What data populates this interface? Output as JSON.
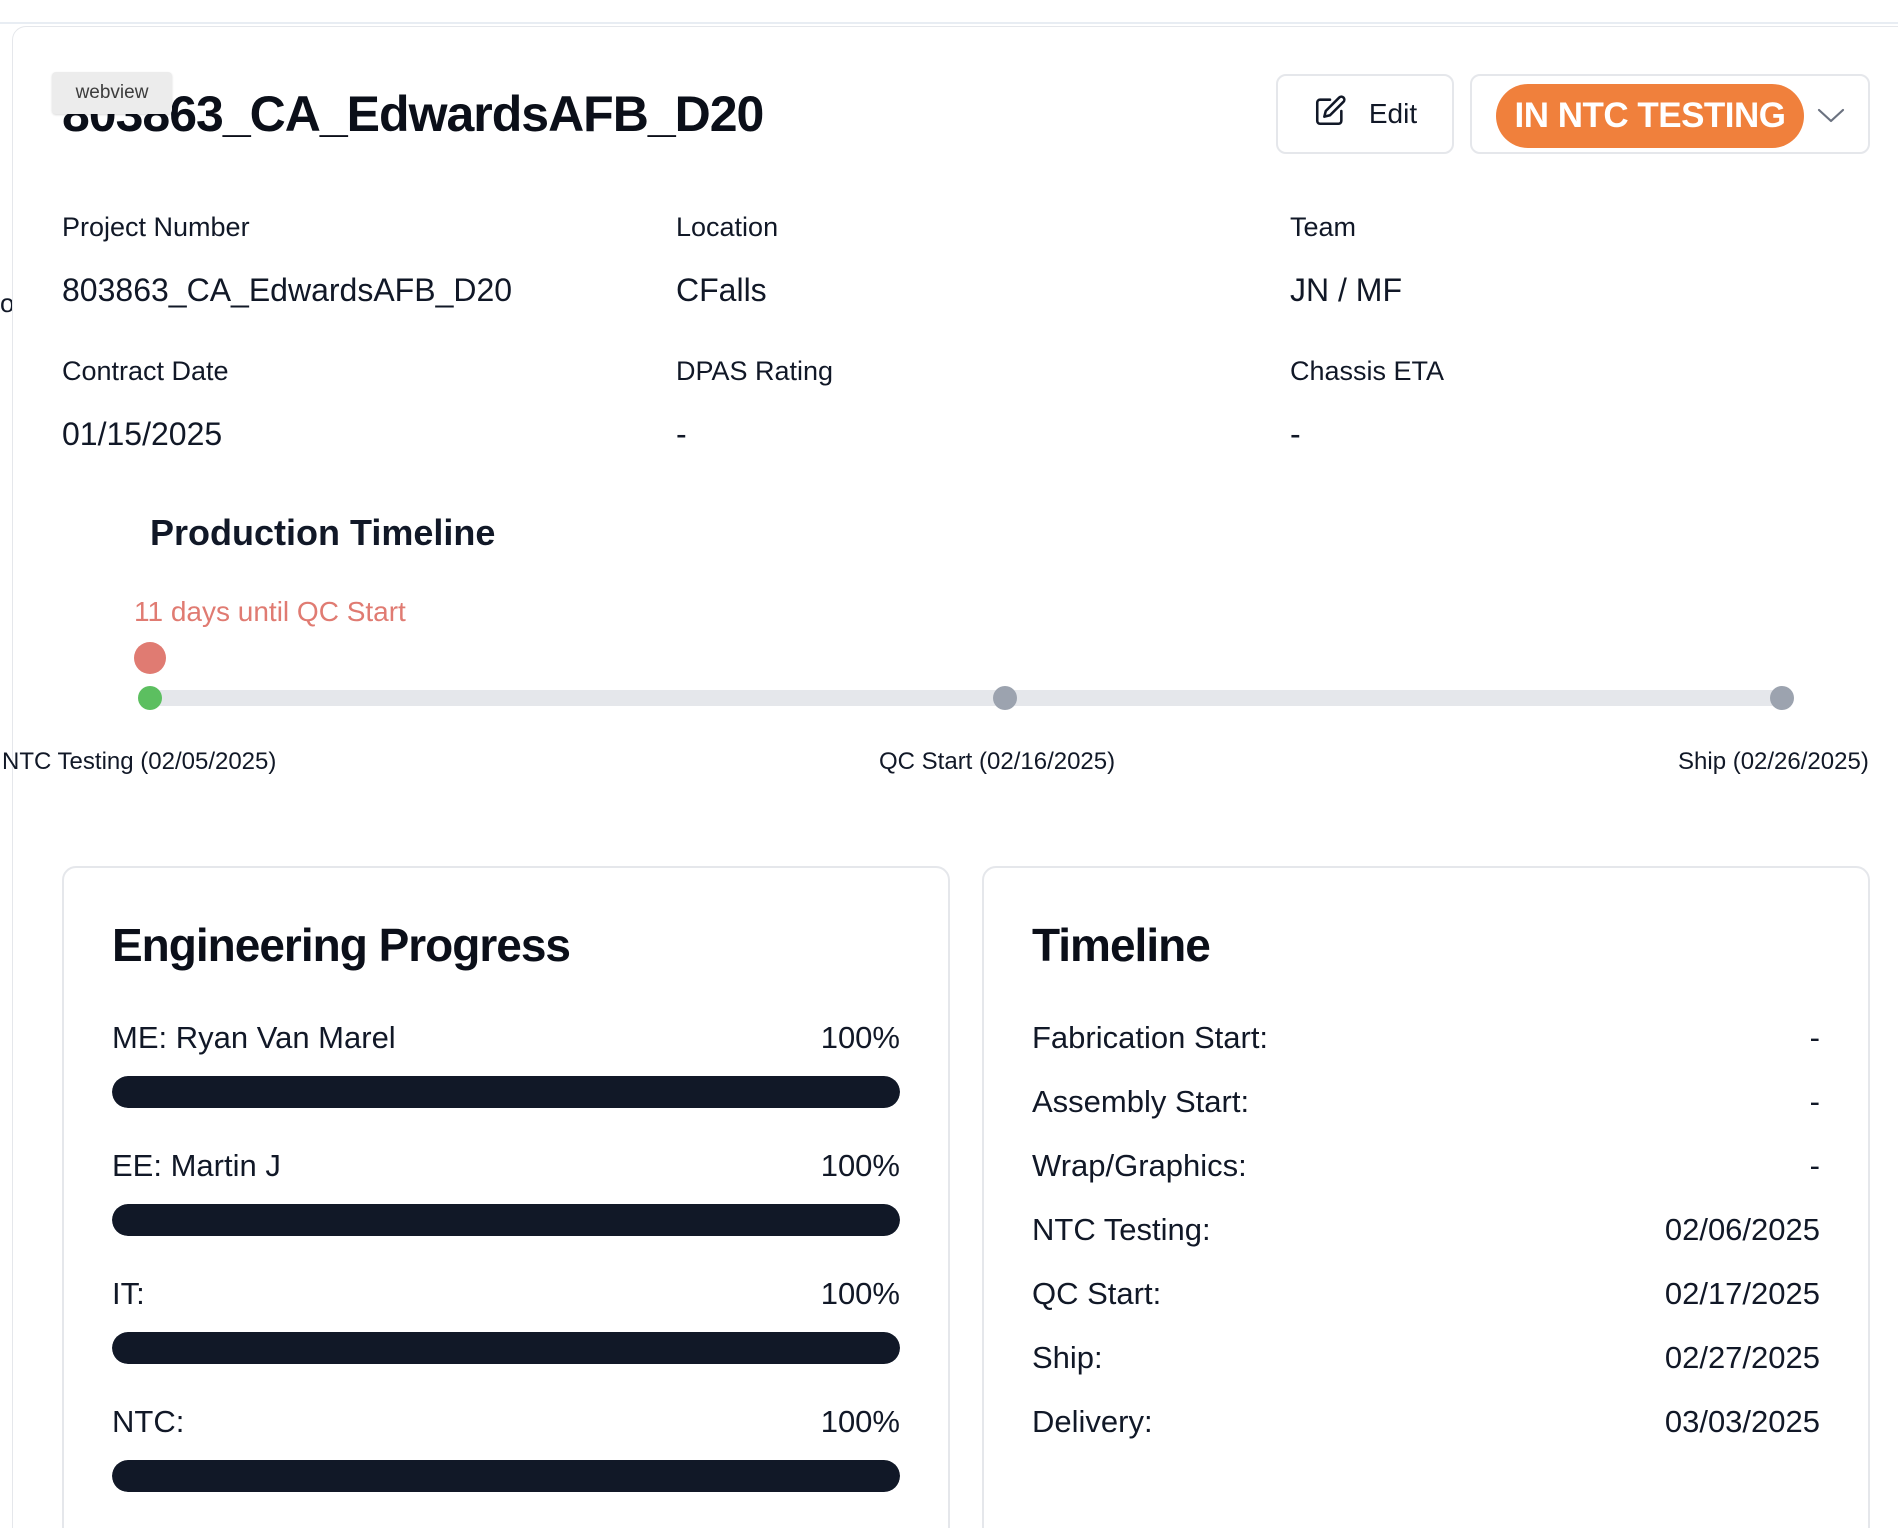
{
  "backdrop": {
    "fragment": "o."
  },
  "webview_tag": "webview",
  "project": {
    "title": "803863_CA_EdwardsAFB_D20",
    "edit_label": "Edit",
    "status_label": "IN NTC TESTING",
    "status_color": "#f0803c"
  },
  "info": [
    {
      "label": "Project Number",
      "value": "803863_CA_EdwardsAFB_D20"
    },
    {
      "label": "Location",
      "value": "CFalls"
    },
    {
      "label": "Team",
      "value": "JN / MF"
    },
    {
      "label": "Contract Date",
      "value": "01/15/2025"
    },
    {
      "label": "DPAS Rating",
      "value": "-"
    },
    {
      "label": "Chassis ETA",
      "value": "-"
    }
  ],
  "production_timeline": {
    "heading": "Production Timeline",
    "countdown": "11 days until QC Start",
    "countdown_color": "#e07b72",
    "milestones": [
      {
        "label": "NTC Testing (02/05/2025)",
        "state": "complete",
        "color": "#5cbf60"
      },
      {
        "label": "QC Start (02/16/2025)",
        "state": "upcoming",
        "color": "#9ca3af"
      },
      {
        "label": "Ship (02/26/2025)",
        "state": "upcoming",
        "color": "#9ca3af"
      }
    ]
  },
  "engineering": {
    "title": "Engineering Progress",
    "items": [
      {
        "name": "ME: Ryan Van Marel",
        "percent_label": "100%",
        "fraction": 1.0
      },
      {
        "name": "EE: Martin J",
        "percent_label": "100%",
        "fraction": 1.0
      },
      {
        "name": "IT:",
        "percent_label": "100%",
        "fraction": 1.0
      },
      {
        "name": "NTC:",
        "percent_label": "100%",
        "fraction": 1.0
      }
    ]
  },
  "timeline": {
    "title": "Timeline",
    "rows": [
      {
        "label": "Fabrication Start:",
        "value": "-"
      },
      {
        "label": "Assembly Start:",
        "value": "-"
      },
      {
        "label": "Wrap/Graphics:",
        "value": "-"
      },
      {
        "label": "NTC Testing:",
        "value": "02/06/2025"
      },
      {
        "label": "QC Start:",
        "value": "02/17/2025"
      },
      {
        "label": "Ship:",
        "value": "02/27/2025"
      },
      {
        "label": "Delivery:",
        "value": "03/03/2025"
      }
    ]
  }
}
